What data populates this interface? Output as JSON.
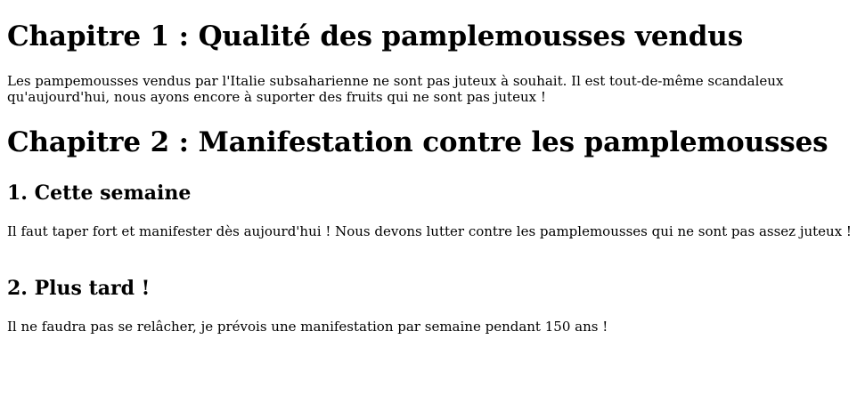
{
  "chapter_1": {
    "title": "Chapitre 1 : Qualité des pamplemousses vendus",
    "paragraph": "Les pampemousses vendus par l'Italie subsaharienne ne sont pas juteux à souhait. Il est tout-de-même scandaleux qu'aujourd'hui, nous ayons encore à suporter des fruits qui ne sont pas juteux !"
  },
  "chapter_2": {
    "title": "Chapitre 2 : Manifestation contre les pamplemousses",
    "sections": [
      {
        "title": "1. Cette semaine",
        "paragraph": "Il faut taper fort et manifester dès aujourd'hui ! Nous devons lutter contre les pamplemousses qui ne sont pas assez juteux !"
      },
      {
        "title": "2. Plus tard !",
        "paragraph": "Il ne faudra pas se relâcher, je prévois une manifestation par semaine pendant 150 ans !"
      }
    ]
  }
}
